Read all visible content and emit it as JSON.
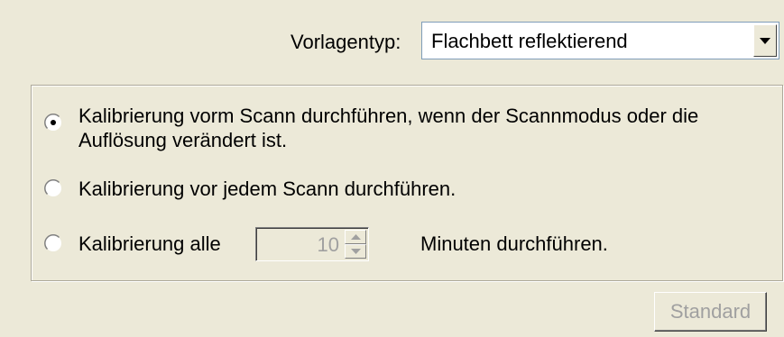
{
  "template_type": {
    "label": "Vorlagentyp:",
    "selected": "Flachbett reflektierend"
  },
  "calibration": {
    "options": [
      {
        "line1": "Kalibrierung vorm Scann durchführen, wenn der Scannmodus oder die",
        "line2": "Auflösung verändert ist.",
        "checked": true
      },
      {
        "line1": "Kalibrierung vor jedem Scann durchführen.",
        "checked": false
      },
      {
        "line1": "Kalibrierung alle",
        "checked": false
      }
    ],
    "interval_value": "10",
    "interval_suffix": "Minuten durchführen."
  },
  "buttons": {
    "standard_label": "Standard"
  }
}
